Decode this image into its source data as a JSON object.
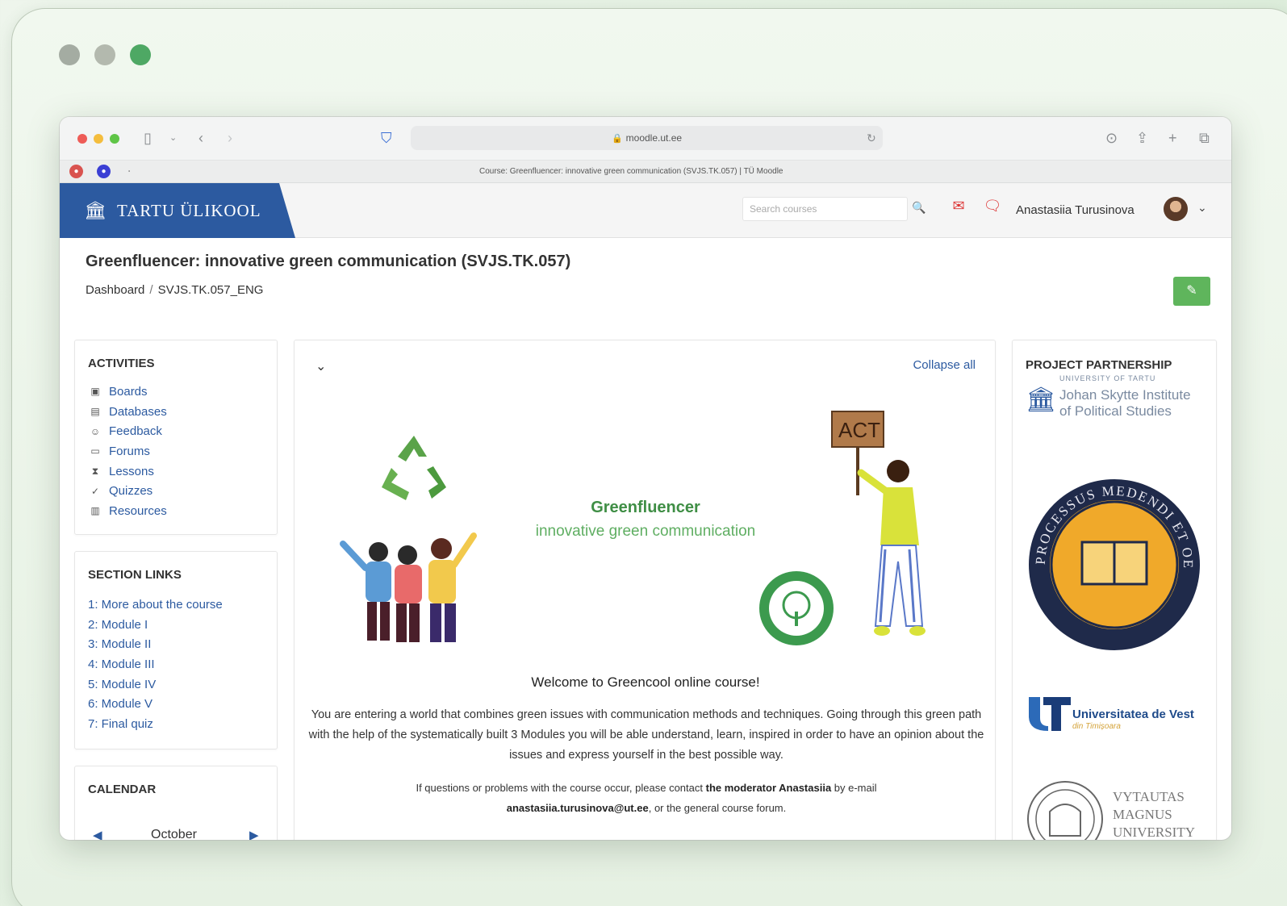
{
  "browser": {
    "url": "moodle.ut.ee",
    "tab_title": "Course: Greenfluencer: innovative green communication (SVJS.TK.057) | TÜ Moodle"
  },
  "site": {
    "brand": "TARTU ÜLIKOOL",
    "search_placeholder": "Search courses",
    "user_name": "Anastasiia Turusinova"
  },
  "course": {
    "title": "Greenfluencer: innovative green communication (SVJS.TK.057)",
    "breadcrumb": [
      "Dashboard",
      "SVJS.TK.057_ENG"
    ]
  },
  "activities": {
    "title": "ACTIVITIES",
    "items": [
      {
        "label": "Boards",
        "icon": "boards-icon"
      },
      {
        "label": "Databases",
        "icon": "database-icon"
      },
      {
        "label": "Feedback",
        "icon": "feedback-icon"
      },
      {
        "label": "Forums",
        "icon": "forum-icon"
      },
      {
        "label": "Lessons",
        "icon": "lesson-icon"
      },
      {
        "label": "Quizzes",
        "icon": "quiz-icon"
      },
      {
        "label": "Resources",
        "icon": "resource-icon"
      }
    ]
  },
  "section_links": {
    "title": "SECTION LINKS",
    "items": [
      "1: More about the course",
      "2: Module I",
      "3: Module II",
      "4: Module III",
      "5: Module IV",
      "6: Module V",
      "7: Final quiz"
    ]
  },
  "calendar": {
    "title": "CALENDAR",
    "month": "October"
  },
  "main": {
    "collapse_all": "Collapse all",
    "banner_title": "Greenfluencer",
    "banner_subtitle": "innovative green communication",
    "sign_text": "ACT",
    "welcome": "Welcome to Greencool online course!",
    "intro": "You are entering a world that combines green issues with communication methods and techniques. Going through this green path with the help of the systematically built 3 Modules you will be able understand, learn, inspired in order to have an opinion about the issues and express yourself in the best possible way.",
    "contact_prefix": "If questions or problems with the course occur, please contact ",
    "contact_person": "the moderator Anastasiia",
    "contact_mid": " by e-mail ",
    "contact_email": "anastasiia.turusinova@ut.ee",
    "contact_suffix": ", or the general course forum."
  },
  "partners": {
    "title": "PROJECT PARTNERSHIP",
    "p1_small": "University of Tartu",
    "p1_line1": "Johan Skytte Institute",
    "p1_line2": "of Political Studies",
    "p2_seal_text": "PROCESSUS MEDENDI ET OECONOMICA",
    "p3_name": "Universitatea de Vest",
    "p3_sub": "din Timișoara",
    "p4_line1": "VYTAUTAS",
    "p4_line2": "MAGNUS",
    "p4_line3": "UNIVERSITY"
  },
  "colors": {
    "brand_blue": "#2c5aa0",
    "green_accent": "#5fb55c",
    "link": "#2c5aa0"
  }
}
